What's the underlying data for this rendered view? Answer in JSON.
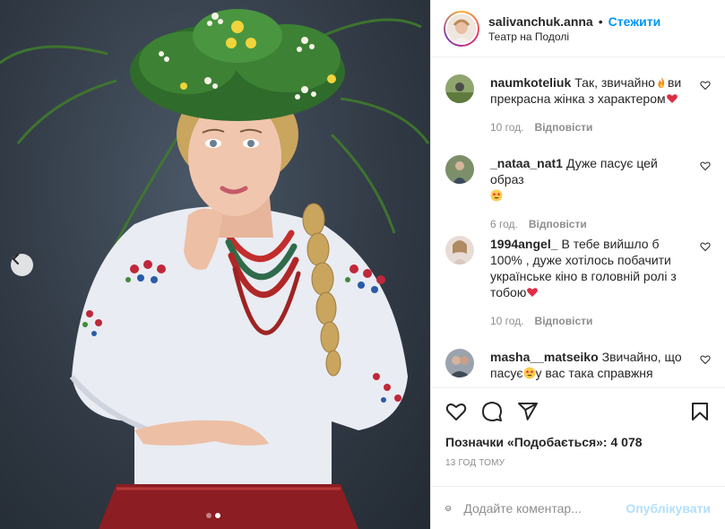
{
  "header": {
    "username": "salivanchuk.anna",
    "separator": "•",
    "follow_label": "Стежити",
    "location": "Театр на Подолі"
  },
  "comments": [
    {
      "user": "naumkoteliuk",
      "text": "Так, звичайно",
      "text2": "ви прекрасна жінка з характером",
      "emoji1": "fire",
      "emoji2": "red-heart",
      "time": "10 год.",
      "reply": "Відповісти"
    },
    {
      "user": "_nataa_nat1",
      "text": "Дуже пасує цей образ",
      "emoji1": "star-struck",
      "time": "6 год.",
      "reply": "Відповісти"
    },
    {
      "user": "1994angel_",
      "text": "В тебе вийшло б 100% , дуже хотілось побачити українське кіно в головній ролі з тобою",
      "emoji1": "red-heart",
      "time": "10 год.",
      "reply": "Відповісти"
    },
    {
      "user": "masha__matseiko",
      "text": "Звичайно, що пасує",
      "text2": "у вас така справжня",
      "emoji1": "star-struck"
    }
  ],
  "actions": {
    "likes_text": "Позначки «Подобається»: 4 078",
    "posted_ago": "13 ГОД ТОМУ"
  },
  "add_comment": {
    "placeholder": "Додайте коментар...",
    "publish_label": "Опублікувати"
  },
  "carousel": {
    "slide_count": 2,
    "active_index": 1
  },
  "colors": {
    "link_blue": "#0095f6",
    "publish_disabled": "#b2dffc",
    "muted": "#8e8e8e",
    "heart_red": "#e0245e"
  }
}
